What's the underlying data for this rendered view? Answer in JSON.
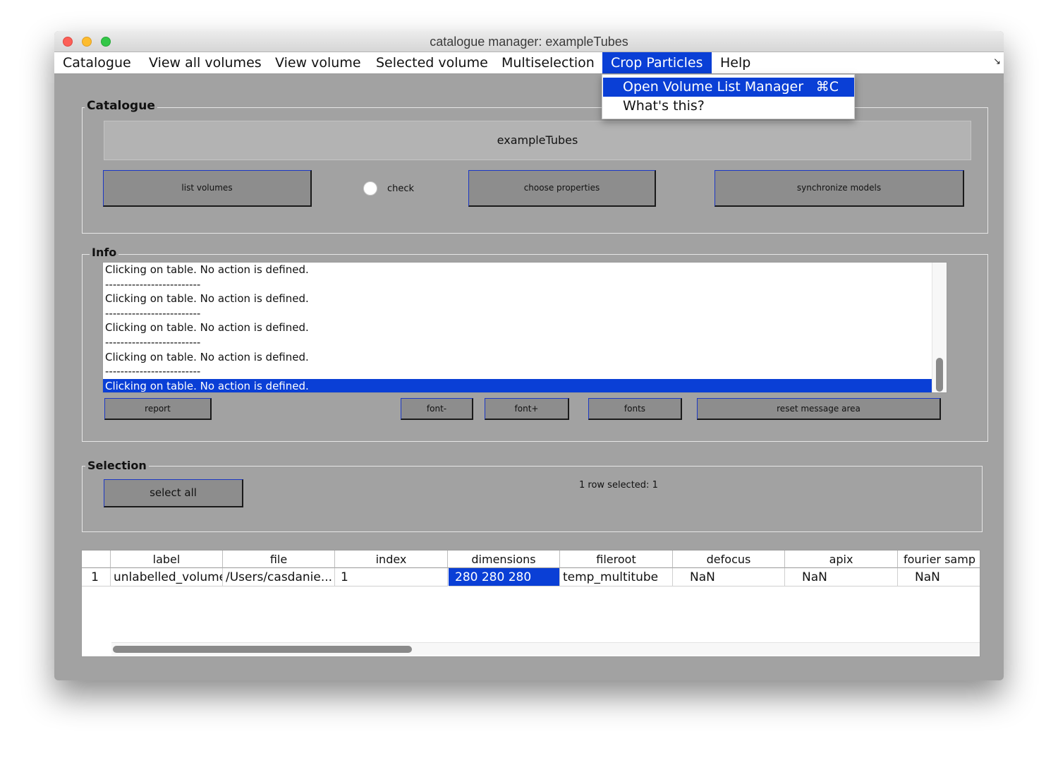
{
  "window": {
    "title": "catalogue manager: exampleTubes"
  },
  "menubar": {
    "items": [
      "Catalogue",
      "View all volumes",
      "View volume",
      "Selected volume",
      "Multiselection",
      "Crop Particles",
      "Help"
    ],
    "active": "Crop Particles",
    "corner_glyph": "↘"
  },
  "dropdown": {
    "items": [
      {
        "label": "Open Volume List Manager",
        "shortcut": "⌘C",
        "highlighted": true
      },
      {
        "label": "What's this?",
        "shortcut": "",
        "highlighted": false
      }
    ]
  },
  "catalogue": {
    "group_label": "Catalogue",
    "name": "exampleTubes",
    "list_volumes_label": "list volumes",
    "check_label": "check",
    "choose_properties_label": "choose properties",
    "synchronize_models_label": "synchronize models"
  },
  "info": {
    "group_label": "Info",
    "lines": [
      "Clicking on table. No action is defined.",
      "-------------------------",
      "Clicking on table. No action is defined.",
      "-------------------------",
      "Clicking on table. No action is defined.",
      "-------------------------",
      "Clicking on table. No action is defined.",
      "-------------------------",
      "Clicking on table. No action is defined."
    ],
    "selected_line": 8,
    "report_label": "report",
    "font_minus_label": "font-",
    "font_plus_label": "font+",
    "fonts_label": "fonts",
    "reset_label": "reset message area"
  },
  "selection": {
    "group_label": "Selection",
    "select_all_label": "select all",
    "status": "1 row selected: 1"
  },
  "table": {
    "columns": [
      "",
      "label",
      "file",
      "index",
      "dimensions",
      "fileroot",
      "defocus",
      "apix",
      "fourier samp"
    ],
    "rows": [
      [
        "1",
        "unlabelled_volume",
        "/Users/casdanie...",
        "1",
        "280  280  280",
        "temp_multitube",
        "NaN",
        "NaN",
        "NaN"
      ]
    ],
    "selected_cell": {
      "row": 0,
      "col": 4
    }
  }
}
